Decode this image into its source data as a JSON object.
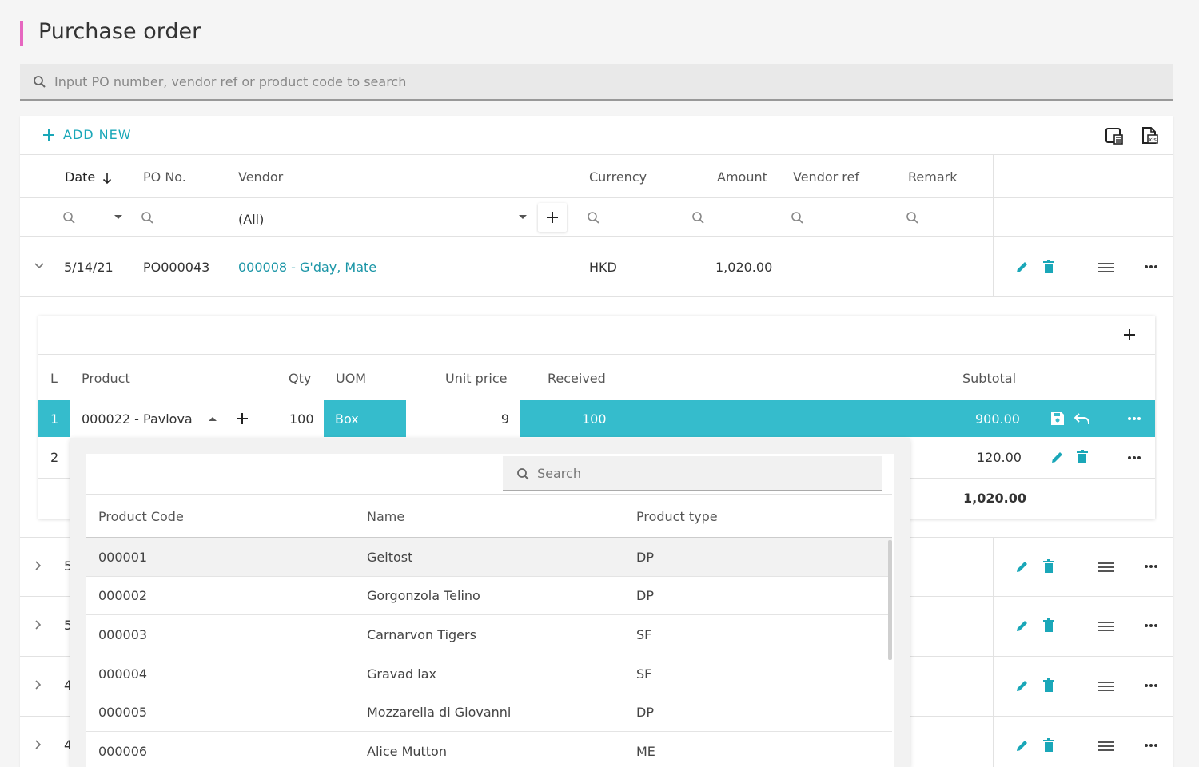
{
  "page": {
    "title": "Purchase order"
  },
  "search": {
    "placeholder": "Input PO number, vendor ref or product code to search"
  },
  "toolbar": {
    "add_new_label": "ADD NEW"
  },
  "table": {
    "headers": {
      "date": "Date",
      "po_no": "PO No.",
      "vendor": "Vendor",
      "currency": "Currency",
      "amount": "Amount",
      "vendor_ref": "Vendor ref",
      "remark": "Remark"
    },
    "vendor_filter": "(All)",
    "expanded_row": {
      "date": "5/14/21",
      "po_no": "PO000043",
      "vendor": "000008 - G'day, Mate",
      "currency": "HKD",
      "amount": "1,020.00"
    },
    "collapsed_rows": [
      {
        "date_prefix": "5"
      },
      {
        "date_prefix": "5"
      },
      {
        "date_prefix": "4"
      },
      {
        "date_prefix": "4"
      }
    ]
  },
  "detail": {
    "headers": {
      "line": "L",
      "product": "Product",
      "qty": "Qty",
      "uom": "UOM",
      "unit_price": "Unit price",
      "received": "Received",
      "subtotal": "Subtotal"
    },
    "lines": [
      {
        "line": "1",
        "product": "000022 - Pavlova",
        "qty": "100",
        "uom": "Box",
        "unit_price": "9",
        "received": "100",
        "subtotal": "900.00"
      },
      {
        "line": "2",
        "subtotal": "120.00"
      }
    ],
    "total": "1,020.00"
  },
  "dropdown": {
    "search_placeholder": "Search",
    "headers": {
      "code": "Product Code",
      "name": "Name",
      "type": "Product type"
    },
    "rows": [
      {
        "code": "000001",
        "name": "Geitost",
        "type": "DP"
      },
      {
        "code": "000002",
        "name": "Gorgonzola Telino",
        "type": "DP"
      },
      {
        "code": "000003",
        "name": "Carnarvon Tigers",
        "type": "SF"
      },
      {
        "code": "000004",
        "name": "Gravad lax",
        "type": "SF"
      },
      {
        "code": "000005",
        "name": "Mozzarella di Giovanni",
        "type": "DP"
      },
      {
        "code": "000006",
        "name": "Alice Mutton",
        "type": "ME"
      }
    ]
  },
  "colors": {
    "accent": "#1aa7b8",
    "selected_row": "#35bccc",
    "title_bar": "#e667c0"
  }
}
